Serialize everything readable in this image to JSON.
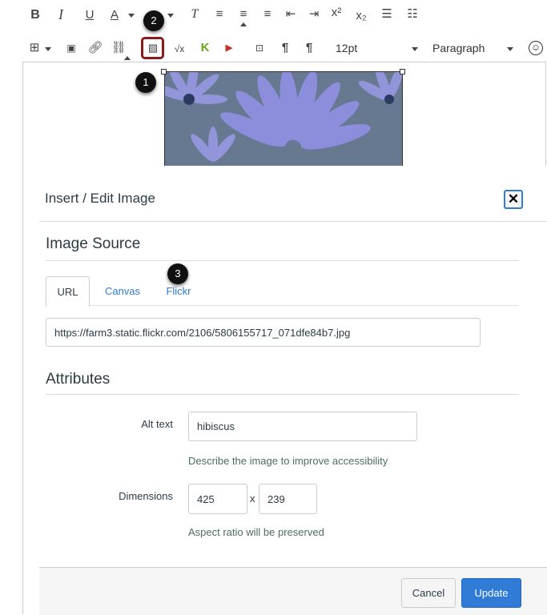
{
  "toolbar": {
    "font_size": "12pt",
    "block_format": "Paragraph"
  },
  "callouts": [
    "1",
    "2",
    "3"
  ],
  "dialog": {
    "title": "Insert / Edit Image",
    "close_symbol": "✕",
    "image_source": {
      "heading": "Image Source",
      "tabs": [
        "URL",
        "Canvas",
        "Flickr"
      ],
      "active_tab": "URL",
      "url_value": "https://farm3.static.flickr.com/2106/5806155717_071dfe84b7.jpg"
    },
    "attributes": {
      "heading": "Attributes",
      "alt_label": "Alt text",
      "alt_value": "hibiscus",
      "alt_hint": "Describe the image to improve accessibility",
      "dimensions_label": "Dimensions",
      "width_value": "425",
      "separator": "x",
      "height_value": "239",
      "dimensions_hint": "Aspect ratio will be preserved"
    },
    "buttons": {
      "cancel": "Cancel",
      "update": "Update"
    }
  },
  "colors": {
    "accent": "#2f7bd5",
    "highlight_border": "#8b1a1a"
  }
}
